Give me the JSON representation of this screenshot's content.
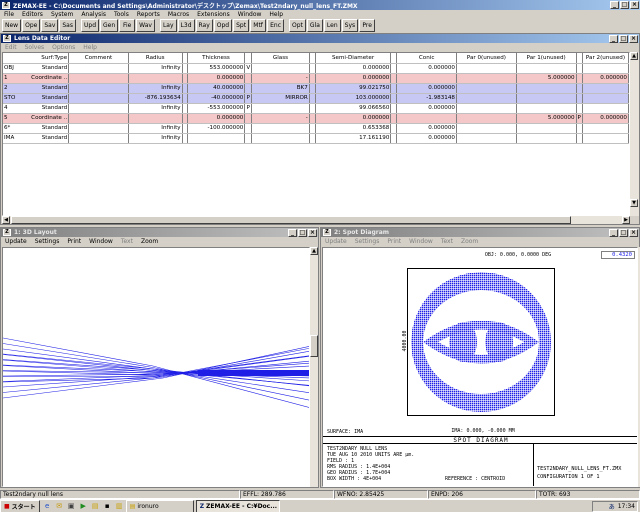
{
  "app": {
    "title": "ZEMAX-EE - C:\\Documents and Settings\\Administrator\\デスクトップ\\Zemax\\Test2ndary_null_lens_FT.ZMX",
    "menu": [
      "File",
      "Editors",
      "System",
      "Analysis",
      "Tools",
      "Reports",
      "Macros",
      "Extensions",
      "Window",
      "Help"
    ],
    "toolbar": [
      "New",
      "Ope",
      "Sav",
      "Sas",
      "Upd",
      "Gen",
      "Fie",
      "Wav",
      "Lay",
      "L3d",
      "Ray",
      "Opd",
      "Spt",
      "Mtf",
      "Enc",
      "Opt",
      "Gla",
      "Len",
      "Sys",
      "Pre"
    ]
  },
  "lde": {
    "title": "Lens Data Editor",
    "menu": [
      "Edit",
      "Solves",
      "Options",
      "Help"
    ],
    "columns": [
      "Surf:Type",
      "Comment",
      "Radius",
      "Thickness",
      "Glass",
      "Semi-Diameter",
      "Conic",
      "Par 0(unused)",
      "Par 1(unused)",
      "Par 2(unused)"
    ],
    "rows": [
      {
        "surf": "OBJ",
        "type": "Standard",
        "comment": "",
        "radius": "Infinity",
        "r_solve": "",
        "thickness": "553.000000",
        "t_solve": "V",
        "glass": "",
        "g_solve": "",
        "semi": "0.000000",
        "s_solve": "",
        "conic": "0.000000",
        "par0": "",
        "par1": "",
        "p1_solve": "",
        "par2": "",
        "cls": "white"
      },
      {
        "surf": "1",
        "type": "Coordinate ..",
        "comment": "",
        "radius": "",
        "r_solve": "",
        "thickness": "0.000000",
        "t_solve": "",
        "glass": "-",
        "g_solve": "",
        "semi": "0.000000",
        "s_solve": "",
        "conic": "",
        "par0": "",
        "par1": "5.000000",
        "p1_solve": "",
        "par2": "0.000000",
        "cls": "pink"
      },
      {
        "surf": "2",
        "type": "Standard",
        "comment": "",
        "radius": "Infinity",
        "r_solve": "",
        "thickness": "40.000000",
        "t_solve": "",
        "glass": "BK7",
        "g_solve": "",
        "semi": "99.021750",
        "s_solve": "",
        "conic": "0.000000",
        "par0": "",
        "par1": "",
        "p1_solve": "",
        "par2": "",
        "cls": "blue"
      },
      {
        "surf": "STO",
        "type": "Standard",
        "comment": "",
        "radius": "-876.193634",
        "r_solve": "",
        "thickness": "-40.000000",
        "t_solve": "P",
        "glass": "MIRROR",
        "g_solve": "",
        "semi": "103.000000",
        "s_solve": "",
        "conic": "-1.983148",
        "par0": "",
        "par1": "",
        "p1_solve": "",
        "par2": "",
        "cls": "blue"
      },
      {
        "surf": "4",
        "type": "Standard",
        "comment": "",
        "radius": "Infinity",
        "r_solve": "",
        "thickness": "-553.000000",
        "t_solve": "P",
        "glass": "",
        "g_solve": "",
        "semi": "99.066560",
        "s_solve": "",
        "conic": "0.000000",
        "par0": "",
        "par1": "",
        "p1_solve": "",
        "par2": "",
        "cls": "white"
      },
      {
        "surf": "5",
        "type": "Coordinate ..",
        "comment": "",
        "radius": "",
        "r_solve": "",
        "thickness": "0.000000",
        "t_solve": "",
        "glass": "-",
        "g_solve": "",
        "semi": "0.000000",
        "s_solve": "",
        "conic": "",
        "par0": "",
        "par1": "5.000000",
        "p1_solve": "P",
        "par2": "0.000000",
        "cls": "pink"
      },
      {
        "surf": "6*",
        "type": "Standard",
        "comment": "",
        "radius": "Infinity",
        "r_solve": "",
        "thickness": "-100.000000",
        "t_solve": "",
        "glass": "",
        "g_solve": "",
        "semi": "0.653368",
        "s_solve": "",
        "conic": "0.000000",
        "par0": "",
        "par1": "",
        "p1_solve": "",
        "par2": "",
        "cls": "white"
      },
      {
        "surf": "IMA",
        "type": "Standard",
        "comment": "",
        "radius": "Infinity",
        "r_solve": "",
        "thickness": "",
        "t_solve": "",
        "glass": "",
        "g_solve": "",
        "semi": "17.161190",
        "s_solve": "",
        "conic": "0.000000",
        "par0": "",
        "par1": "",
        "p1_solve": "",
        "par2": "",
        "cls": "white"
      }
    ]
  },
  "layout": {
    "title": "1: 3D Layout",
    "menu": [
      "Update",
      "Settings",
      "Print",
      "Window",
      "Text",
      "Zoom"
    ]
  },
  "spot": {
    "title": "2: Spot Diagram",
    "menu": [
      "Update",
      "Settings",
      "Print",
      "Window",
      "Text",
      "Zoom"
    ],
    "legend_value": "0.4320",
    "obj_label": "OBJ: 0.000, 0.0000 DEG",
    "axis_label": "4000.00",
    "ima_label": "IMA: 0.000, -0.000 MM",
    "surface_label": "SURFACE: IMA",
    "diagram_title": "SPOT DIAGRAM",
    "info_lines": [
      "TEST2NDARY NULL LENS",
      "TUE AUG 10 2010  UNITS ARE µm.",
      "FIELD       :        1",
      "RMS RADIUS  :    1.4E+004",
      "GEO RADIUS  :    1.7E+004",
      "BOX WIDTH   :    4E+004"
    ],
    "reference": "REFERENCE  :  CENTROID",
    "file_name": "TEST2NDARY_NULL_LENS_FT.ZMX",
    "configuration": "CONFIGURATION  1  OF  1"
  },
  "status": {
    "title": "Test2ndary null lens",
    "effl": "EFFL: 289.786",
    "wfno": "WFNO: 2.85425",
    "enpd": "ENPD: 206",
    "totr": "TOTR: 693"
  },
  "taskbar": {
    "start": "スタート",
    "tasks": [
      "ironuro",
      "ZEMAX-EE - C:¥Doc..."
    ],
    "time": "17:34"
  },
  "colors": {
    "spot_blue": "#1e1ee6",
    "title_active": "#0a246a"
  }
}
